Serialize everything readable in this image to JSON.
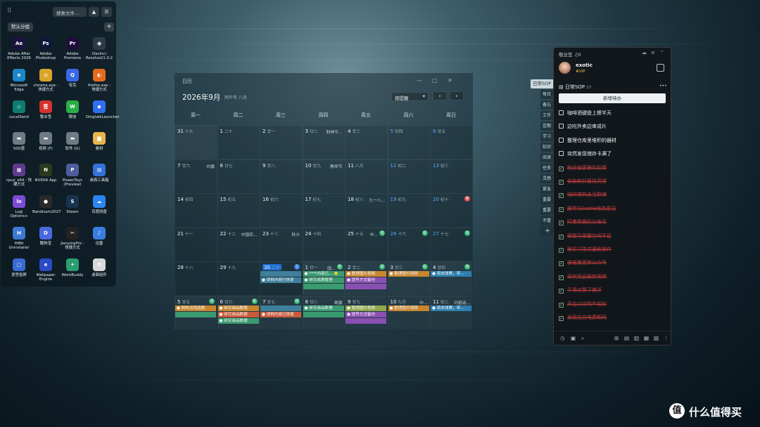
{
  "desktop_panel": {
    "search_placeholder": "搜索文件...",
    "up_button": "▲",
    "menu_button": "☰",
    "group_label": "默认分组",
    "add_button": "+",
    "apps": [
      {
        "label": "Adobe After Effects 2026",
        "glyph": "Ae",
        "color": "#1b1240"
      },
      {
        "label": "Adobe Photoshop",
        "glyph": "Ps",
        "color": "#0a1a36"
      },
      {
        "label": "Adobe Premiere",
        "glyph": "Pr",
        "color": "#1d0e3a"
      },
      {
        "label": "Davinci Resolve21.0.2",
        "glyph": "◉",
        "color": "#2d3a49"
      },
      {
        "label": "Microsoft Edge",
        "glyph": "e",
        "color": "#1b86c9"
      },
      {
        "label": "chrome.exe - 快捷方式",
        "glyph": "◎",
        "color": "#d8a52a"
      },
      {
        "label": "夸克",
        "glyph": "Q",
        "color": "#3a68e8"
      },
      {
        "label": "firefox.exe - 快捷方式",
        "glyph": "◐",
        "color": "#e66a1d"
      },
      {
        "label": "LocalSend",
        "glyph": "◇",
        "color": "#0d7c70"
      },
      {
        "label": "敬业签",
        "glyph": "签",
        "color": "#d4322c"
      },
      {
        "label": "微信",
        "glyph": "W",
        "color": "#27b046"
      },
      {
        "label": "DingtalkLauncher",
        "glyph": "◆",
        "color": "#2f6ff0"
      },
      {
        "label": "SSD盘",
        "glyph": "▬",
        "color": "#6f7b82"
      },
      {
        "label": "视频 (F)",
        "glyph": "▬",
        "color": "#6f7b82"
      },
      {
        "label": "软件 (G)",
        "glyph": "▬",
        "color": "#6f7b82"
      },
      {
        "label": "素材",
        "glyph": "▆",
        "color": "#e5b64a"
      },
      {
        "label": "cpuz_x64 - 快捷方式",
        "glyph": "▦",
        "color": "#5d3a8e"
      },
      {
        "label": "NVIDIA App",
        "glyph": "N",
        "color": "#2b3a1f"
      },
      {
        "label": "PowerToys (Preview)",
        "glyph": "P",
        "color": "#4c5c9c"
      },
      {
        "label": "桌面工具箱",
        "glyph": "▤",
        "color": "#3372d8"
      },
      {
        "label": "Logi Options+",
        "glyph": "lo",
        "color": "#7c4ad8"
      },
      {
        "label": "Bandicam2027",
        "glyph": "●",
        "color": "#2a2a2a"
      },
      {
        "label": "Steam",
        "glyph": "S",
        "color": "#18334e"
      },
      {
        "label": "百度网盘",
        "glyph": "☁",
        "color": "#2b84f0"
      },
      {
        "label": "HiBit Uninstaller",
        "glyph": "H",
        "color": "#3f79d6"
      },
      {
        "label": "酷狗宝",
        "glyph": "D",
        "color": "#4a68e0"
      },
      {
        "label": "JianyingPro - 快捷方式",
        "glyph": "✂",
        "color": "#222222"
      },
      {
        "label": "迅雷",
        "glyph": "♪",
        "color": "#3a7ee0"
      },
      {
        "label": "爱思投屏",
        "glyph": "▢",
        "color": "#3a6ad4"
      },
      {
        "label": "Wallpaper Engine",
        "glyph": "e",
        "color": "#2a4ac4"
      },
      {
        "label": "WorkBuddy",
        "glyph": "✦",
        "color": "#2a9e70"
      },
      {
        "label": "桌面组件",
        "glyph": "✿",
        "color": "#d7d7d7"
      }
    ]
  },
  "calendar": {
    "window_title": "日历",
    "controls": [
      "—",
      "□",
      "✕"
    ],
    "month_title": "2026年9月",
    "lunar_title": "丙午年 八月",
    "reminder_select": "按提醒",
    "prev": "‹",
    "next": "›",
    "weekdays": [
      "周一",
      "周二",
      "周三",
      "周四",
      "周五",
      "周六",
      "周日"
    ],
    "weeks": [
      [
        {
          "n": "31",
          "l": "十九",
          "dim": true
        },
        {
          "n": "1",
          "l": "二十"
        },
        {
          "n": "2",
          "l": "廿一"
        },
        {
          "n": "3",
          "l": "廿二",
          "t": "财神节..."
        },
        {
          "n": "4",
          "l": "廿三"
        },
        {
          "n": "5",
          "l": "廿四",
          "blue": true
        },
        {
          "n": "6",
          "l": "廿五",
          "blue": true
        }
      ],
      [
        {
          "n": "7",
          "l": "廿六",
          "t": "白露"
        },
        {
          "n": "8",
          "l": "廿七"
        },
        {
          "n": "9",
          "l": "廿八"
        },
        {
          "n": "10",
          "l": "廿九",
          "t": "教师节"
        },
        {
          "n": "11",
          "l": "八月"
        },
        {
          "n": "12",
          "l": "初二",
          "blue": true
        },
        {
          "n": "13",
          "l": "初三",
          "blue": true
        }
      ],
      [
        {
          "n": "14",
          "l": "初四"
        },
        {
          "n": "15",
          "l": "初五"
        },
        {
          "n": "16",
          "l": "初六"
        },
        {
          "n": "17",
          "l": "初七"
        },
        {
          "n": "18",
          "l": "初八",
          "t": "九一八..."
        },
        {
          "n": "19",
          "l": "初九",
          "blue": true
        },
        {
          "n": "20",
          "l": "初十",
          "blue": true,
          "b": "休",
          "bc": "#e0505a"
        }
      ],
      [
        {
          "n": "21",
          "l": "十一"
        },
        {
          "n": "22",
          "l": "十二",
          "t": "中国农..."
        },
        {
          "n": "23",
          "l": "十三",
          "t": "秋分"
        },
        {
          "n": "24",
          "l": "十四"
        },
        {
          "n": "25",
          "l": "十五",
          "t": "中...",
          "b": "班",
          "bc": "#2fae6e"
        },
        {
          "n": "26",
          "l": "十六",
          "blue": true,
          "b": "班",
          "bc": "#2fae6e"
        },
        {
          "n": "27",
          "l": "十七",
          "blue": true,
          "b": "班",
          "bc": "#2fae6e"
        }
      ],
      [
        {
          "n": "28",
          "l": "十八"
        },
        {
          "n": "29",
          "l": "十九"
        },
        {
          "n": "30",
          "l": "二十",
          "today": true,
          "b": "2",
          "bc": "#3a82e0"
        },
        {
          "n": "1",
          "l": "廿一",
          "t": "国...",
          "dim": true,
          "b": "班",
          "bc": "#2fae6e"
        },
        {
          "n": "2",
          "l": "廿二",
          "dim": true,
          "b": "班",
          "bc": "#2fae6e"
        },
        {
          "n": "3",
          "l": "廿三",
          "dim": true,
          "b": "班",
          "bc": "#2fae6e"
        },
        {
          "n": "4",
          "l": "廿四",
          "dim": true,
          "b": "班",
          "bc": "#2fae6e"
        }
      ],
      [
        {
          "n": "5",
          "l": "廿五",
          "dim": true,
          "b": "班",
          "bc": "#2fae6e"
        },
        {
          "n": "6",
          "l": "廿六",
          "dim": true,
          "b": "班",
          "bc": "#2fae6e"
        },
        {
          "n": "7",
          "l": "廿七",
          "dim": true,
          "b": "班",
          "bc": "#2fae6e"
        },
        {
          "n": "8",
          "l": "廿八",
          "t": "寒露",
          "dim": true
        },
        {
          "n": "9",
          "l": "廿九",
          "dim": true
        },
        {
          "n": "10",
          "l": "九月",
          "t": "中...",
          "dim": true
        },
        {
          "n": "11",
          "l": "初二",
          "t": "玛祖诞...",
          "dim": true
        }
      ]
    ],
    "events": [
      {
        "w": 4,
        "d": 2,
        "slot": 0,
        "text": "",
        "color": "#3f7f9c"
      },
      {
        "w": 4,
        "d": 2,
        "slot": 1,
        "text": "● 读档内容已恢复",
        "color": "#3f7f9c"
      },
      {
        "w": 4,
        "d": 3,
        "slot": 0,
        "text": "● ****内容已... ⭐",
        "color": "#3a9a70"
      },
      {
        "w": 4,
        "d": 3,
        "slot": 1,
        "text": "● 研究成果整理",
        "color": "#3a9a70"
      },
      {
        "w": 4,
        "d": 3,
        "slot": 2,
        "text": "",
        "color": "#3a9a70"
      },
      {
        "w": 4,
        "d": 4,
        "slot": 0,
        "text": "● 整理图片视频",
        "color": "#c8862e"
      },
      {
        "w": 4,
        "d": 4,
        "slot": 1,
        "text": "● 提早方式备份",
        "color": "#8a4fb3"
      },
      {
        "w": 4,
        "d": 4,
        "slot": 2,
        "text": "",
        "color": "#8a4fb3"
      },
      {
        "w": 4,
        "d": 5,
        "slot": 0,
        "text": "● 整理图片视频",
        "color": "#c8862e"
      },
      {
        "w": 4,
        "d": 6,
        "slot": 0,
        "text": "● 周末球赛，带...",
        "color": "#2f7fb0"
      },
      {
        "w": 5,
        "d": 0,
        "slot": 0,
        "text": "● 刷热点找选题",
        "color": "#c8862e"
      },
      {
        "w": 5,
        "d": 0,
        "slot": 1,
        "text": "",
        "color": "#3a9a70"
      },
      {
        "w": 5,
        "d": 1,
        "slot": 0,
        "text": "● 研究商品数据",
        "color": "#c8862e"
      },
      {
        "w": 5,
        "d": 1,
        "slot": 1,
        "text": "● 研究商品数据",
        "color": "#c85a3a"
      },
      {
        "w": 5,
        "d": 1,
        "slot": 2,
        "text": "● 研究商品数据",
        "color": "#3a9a70"
      },
      {
        "w": 5,
        "d": 2,
        "slot": 0,
        "text": "",
        "color": "#3f7f9c"
      },
      {
        "w": 5,
        "d": 2,
        "slot": 1,
        "text": "● 读档内容已恢复",
        "color": "#c85a3a"
      },
      {
        "w": 5,
        "d": 3,
        "slot": 0,
        "text": "● 研究商品数据",
        "color": "#3a9a70"
      },
      {
        "w": 5,
        "d": 3,
        "slot": 1,
        "text": "",
        "color": "#3a9a70"
      },
      {
        "w": 5,
        "d": 4,
        "slot": 0,
        "text": "● 整理图片视频",
        "color": "#8fa84a"
      },
      {
        "w": 5,
        "d": 4,
        "slot": 1,
        "text": "● 提早方式备份",
        "color": "#8a4fb3"
      },
      {
        "w": 5,
        "d": 4,
        "slot": 2,
        "text": "",
        "color": "#8a4fb3"
      },
      {
        "w": 5,
        "d": 5,
        "slot": 0,
        "text": "● 整理图片视频",
        "color": "#c8862e"
      },
      {
        "w": 5,
        "d": 6,
        "slot": 0,
        "text": "● 周末球赛，带...",
        "color": "#2f7fb0"
      }
    ]
  },
  "side_tabs": {
    "active": "日常SOP",
    "items": [
      "每日",
      "备忘",
      "工作",
      "定期",
      "学习",
      "知识",
      "阅读",
      "任务",
      "灵感",
      "紧急",
      "重要",
      "重要",
      "不重"
    ],
    "add": "+"
  },
  "sop_panel": {
    "app_name": "敬业签",
    "notify_count": "0",
    "username": "exotic",
    "vip": "VIP",
    "section_title": "日常SOP",
    "section_count": "17",
    "more": "•••",
    "new_task_label": "新增待办",
    "tasks": [
      {
        "text": "咖啡洒键盘上擦半天",
        "done": false
      },
      {
        "text": "边吃外卖边审成片",
        "done": false
      },
      {
        "text": "整理仓库里堆积的器材",
        "done": false
      },
      {
        "text": "突然发现储存卡满了",
        "done": false
      },
      {
        "text": "粉丝催更据实反馈",
        "done": true
      },
      {
        "text": "偷偷刷抖音找灵感",
        "done": true
      },
      {
        "text": "临时被抓去当群演",
        "done": true
      },
      {
        "text": "跟甲方battle修改意见",
        "done": true
      },
      {
        "text": "盯着数据后台发呆",
        "done": true
      },
      {
        "text": "硬盘又报警空间不足",
        "done": true
      },
      {
        "text": "跟实习生讲基础操作",
        "done": true
      },
      {
        "text": "被催着更新公众号",
        "done": true
      },
      {
        "text": "研究竞品最新视频",
        "done": true
      },
      {
        "text": "手滑点赞了差评",
        "done": true
      },
      {
        "text": "开会讨论明年规划",
        "done": true
      },
      {
        "text": "发现店交电费断网",
        "done": true
      }
    ],
    "footer_icons": [
      "◷",
      "▣",
      "⌕",
      "⊞",
      "▤",
      "▥",
      "▦",
      "▧",
      "⋮"
    ]
  },
  "watermark": {
    "badge": "值",
    "text": "什么值得买"
  }
}
